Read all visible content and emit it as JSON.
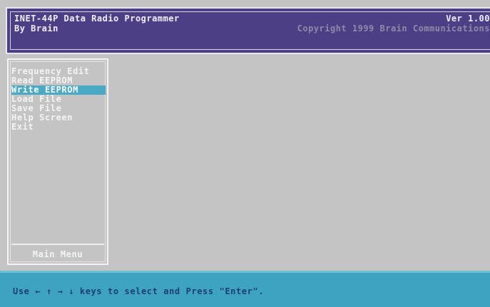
{
  "header": {
    "title": "INET-44P Data Radio Programmer",
    "subtitle": "By Brain",
    "version": "Ver 1.00",
    "copyright": "Copyright 1999 Brain Communications"
  },
  "menu": {
    "items": [
      {
        "label": "Frequency Edit"
      },
      {
        "label": "Read EEPROM"
      },
      {
        "label": "Write EEPROM"
      },
      {
        "label": "Load File"
      },
      {
        "label": "Save File"
      },
      {
        "label": "Help Screen"
      },
      {
        "label": "Exit"
      }
    ],
    "selected_index": 2,
    "footer": "Main Menu"
  },
  "status": {
    "text": "Use ← ↑ → ↓ keys to select and Press \"Enter\"."
  },
  "colors": {
    "header_bg": "#4d3f86",
    "selection": "#4aa9c4",
    "statusbar_bg": "#3ea3c0",
    "screen_bg": "#c4c4c4"
  }
}
